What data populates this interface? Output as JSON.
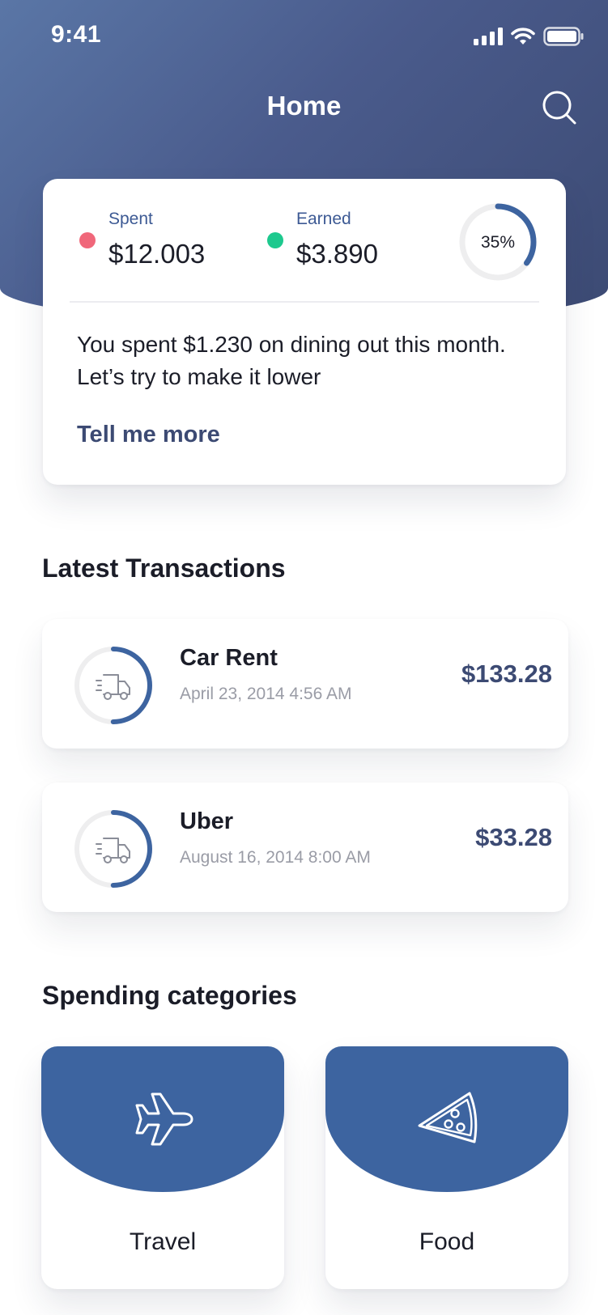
{
  "status_bar": {
    "time": "9:41"
  },
  "header": {
    "title": "Home",
    "search_icon": "search-icon"
  },
  "summary": {
    "spent_label": "Spent",
    "spent_value": "$12.003",
    "earned_label": "Earned",
    "earned_value": "$3.890",
    "progress_text": "35%",
    "progress_fraction": 0.35,
    "message": "You spent $1.230 on dining out this month. Let’s try to make it lower",
    "link_label": "Tell me more"
  },
  "transactions": {
    "title": "Latest Transactions",
    "items": [
      {
        "name": "Car Rent",
        "date": "April 23, 2014 4:56 AM",
        "amount": "$133.28",
        "icon": "delivery-truck-icon",
        "progress_fraction": 0.5
      },
      {
        "name": "Uber",
        "date": "August 16, 2014 8:00 AM",
        "amount": "$33.28",
        "icon": "delivery-truck-icon",
        "progress_fraction": 0.5
      }
    ]
  },
  "categories": {
    "title": "Spending categories",
    "items": [
      {
        "label": "Travel",
        "icon": "airplane-icon"
      },
      {
        "label": "Food",
        "icon": "pizza-slice-icon"
      }
    ]
  },
  "colors": {
    "header_gradient_start": "#5a76a6",
    "header_gradient_end": "#3c4a73",
    "accent": "#3d64a0",
    "spent_dot": "#f0677a",
    "earned_dot": "#1dc98e",
    "amount_text": "#3c4a73",
    "ring_track": "#eeeeef"
  }
}
